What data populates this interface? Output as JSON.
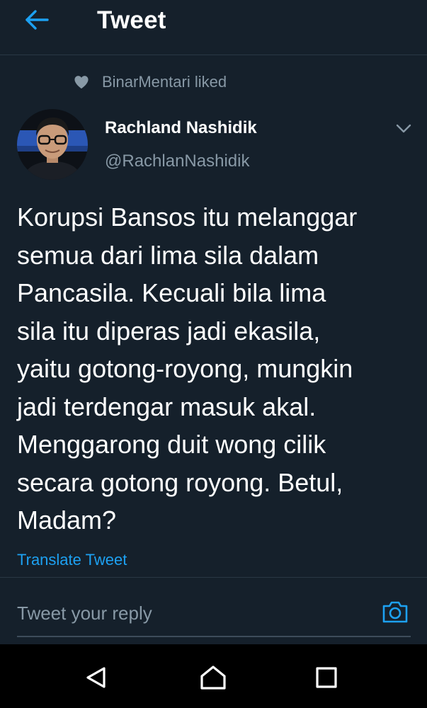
{
  "header": {
    "title": "Tweet",
    "back_icon": "arrow-left-icon"
  },
  "context": {
    "icon": "heart-icon",
    "text": "BinarMentari liked"
  },
  "tweet": {
    "author_name": "Rachland Nashidik",
    "author_handle": "@RachlanNashidik",
    "text": "Korupsi Bansos itu melanggar\nsemua dari lima sila dalam\nPancasila. Kecuali bila lima\nsila itu diperas jadi ekasila,\nyaitu gotong-royong, mungkin\njadi terdengar masuk akal.\nMenggarong duit wong cilik\nsecara gotong royong. Betul,\nMadam?",
    "translate_label": "Translate Tweet"
  },
  "reply": {
    "placeholder": "Tweet your reply",
    "camera_icon": "camera-icon"
  },
  "colors": {
    "background": "#15202b",
    "accent": "#1da1f2",
    "secondary_text": "#8899a6",
    "divider": "#2a3744"
  }
}
